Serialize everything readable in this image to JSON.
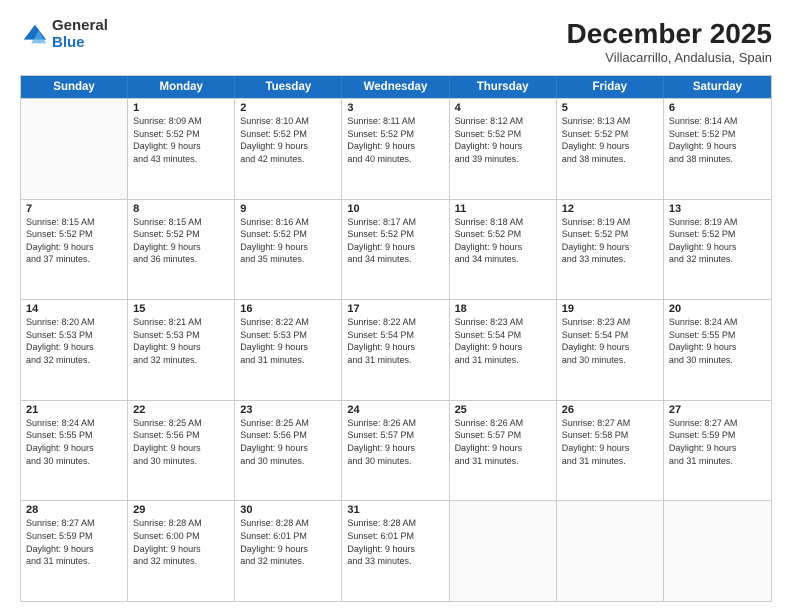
{
  "logo": {
    "line1": "General",
    "line2": "Blue"
  },
  "title": "December 2025",
  "subtitle": "Villacarrillo, Andalusia, Spain",
  "header_days": [
    "Sunday",
    "Monday",
    "Tuesday",
    "Wednesday",
    "Thursday",
    "Friday",
    "Saturday"
  ],
  "weeks": [
    [
      {
        "day": "",
        "info": ""
      },
      {
        "day": "1",
        "info": "Sunrise: 8:09 AM\nSunset: 5:52 PM\nDaylight: 9 hours\nand 43 minutes."
      },
      {
        "day": "2",
        "info": "Sunrise: 8:10 AM\nSunset: 5:52 PM\nDaylight: 9 hours\nand 42 minutes."
      },
      {
        "day": "3",
        "info": "Sunrise: 8:11 AM\nSunset: 5:52 PM\nDaylight: 9 hours\nand 40 minutes."
      },
      {
        "day": "4",
        "info": "Sunrise: 8:12 AM\nSunset: 5:52 PM\nDaylight: 9 hours\nand 39 minutes."
      },
      {
        "day": "5",
        "info": "Sunrise: 8:13 AM\nSunset: 5:52 PM\nDaylight: 9 hours\nand 38 minutes."
      },
      {
        "day": "6",
        "info": "Sunrise: 8:14 AM\nSunset: 5:52 PM\nDaylight: 9 hours\nand 38 minutes."
      }
    ],
    [
      {
        "day": "7",
        "info": "Sunrise: 8:15 AM\nSunset: 5:52 PM\nDaylight: 9 hours\nand 37 minutes."
      },
      {
        "day": "8",
        "info": "Sunrise: 8:15 AM\nSunset: 5:52 PM\nDaylight: 9 hours\nand 36 minutes."
      },
      {
        "day": "9",
        "info": "Sunrise: 8:16 AM\nSunset: 5:52 PM\nDaylight: 9 hours\nand 35 minutes."
      },
      {
        "day": "10",
        "info": "Sunrise: 8:17 AM\nSunset: 5:52 PM\nDaylight: 9 hours\nand 34 minutes."
      },
      {
        "day": "11",
        "info": "Sunrise: 8:18 AM\nSunset: 5:52 PM\nDaylight: 9 hours\nand 34 minutes."
      },
      {
        "day": "12",
        "info": "Sunrise: 8:19 AM\nSunset: 5:52 PM\nDaylight: 9 hours\nand 33 minutes."
      },
      {
        "day": "13",
        "info": "Sunrise: 8:19 AM\nSunset: 5:52 PM\nDaylight: 9 hours\nand 32 minutes."
      }
    ],
    [
      {
        "day": "14",
        "info": "Sunrise: 8:20 AM\nSunset: 5:53 PM\nDaylight: 9 hours\nand 32 minutes."
      },
      {
        "day": "15",
        "info": "Sunrise: 8:21 AM\nSunset: 5:53 PM\nDaylight: 9 hours\nand 32 minutes."
      },
      {
        "day": "16",
        "info": "Sunrise: 8:22 AM\nSunset: 5:53 PM\nDaylight: 9 hours\nand 31 minutes."
      },
      {
        "day": "17",
        "info": "Sunrise: 8:22 AM\nSunset: 5:54 PM\nDaylight: 9 hours\nand 31 minutes."
      },
      {
        "day": "18",
        "info": "Sunrise: 8:23 AM\nSunset: 5:54 PM\nDaylight: 9 hours\nand 31 minutes."
      },
      {
        "day": "19",
        "info": "Sunrise: 8:23 AM\nSunset: 5:54 PM\nDaylight: 9 hours\nand 30 minutes."
      },
      {
        "day": "20",
        "info": "Sunrise: 8:24 AM\nSunset: 5:55 PM\nDaylight: 9 hours\nand 30 minutes."
      }
    ],
    [
      {
        "day": "21",
        "info": "Sunrise: 8:24 AM\nSunset: 5:55 PM\nDaylight: 9 hours\nand 30 minutes."
      },
      {
        "day": "22",
        "info": "Sunrise: 8:25 AM\nSunset: 5:56 PM\nDaylight: 9 hours\nand 30 minutes."
      },
      {
        "day": "23",
        "info": "Sunrise: 8:25 AM\nSunset: 5:56 PM\nDaylight: 9 hours\nand 30 minutes."
      },
      {
        "day": "24",
        "info": "Sunrise: 8:26 AM\nSunset: 5:57 PM\nDaylight: 9 hours\nand 30 minutes."
      },
      {
        "day": "25",
        "info": "Sunrise: 8:26 AM\nSunset: 5:57 PM\nDaylight: 9 hours\nand 31 minutes."
      },
      {
        "day": "26",
        "info": "Sunrise: 8:27 AM\nSunset: 5:58 PM\nDaylight: 9 hours\nand 31 minutes."
      },
      {
        "day": "27",
        "info": "Sunrise: 8:27 AM\nSunset: 5:59 PM\nDaylight: 9 hours\nand 31 minutes."
      }
    ],
    [
      {
        "day": "28",
        "info": "Sunrise: 8:27 AM\nSunset: 5:59 PM\nDaylight: 9 hours\nand 31 minutes."
      },
      {
        "day": "29",
        "info": "Sunrise: 8:28 AM\nSunset: 6:00 PM\nDaylight: 9 hours\nand 32 minutes."
      },
      {
        "day": "30",
        "info": "Sunrise: 8:28 AM\nSunset: 6:01 PM\nDaylight: 9 hours\nand 32 minutes."
      },
      {
        "day": "31",
        "info": "Sunrise: 8:28 AM\nSunset: 6:01 PM\nDaylight: 9 hours\nand 33 minutes."
      },
      {
        "day": "",
        "info": ""
      },
      {
        "day": "",
        "info": ""
      },
      {
        "day": "",
        "info": ""
      }
    ]
  ]
}
